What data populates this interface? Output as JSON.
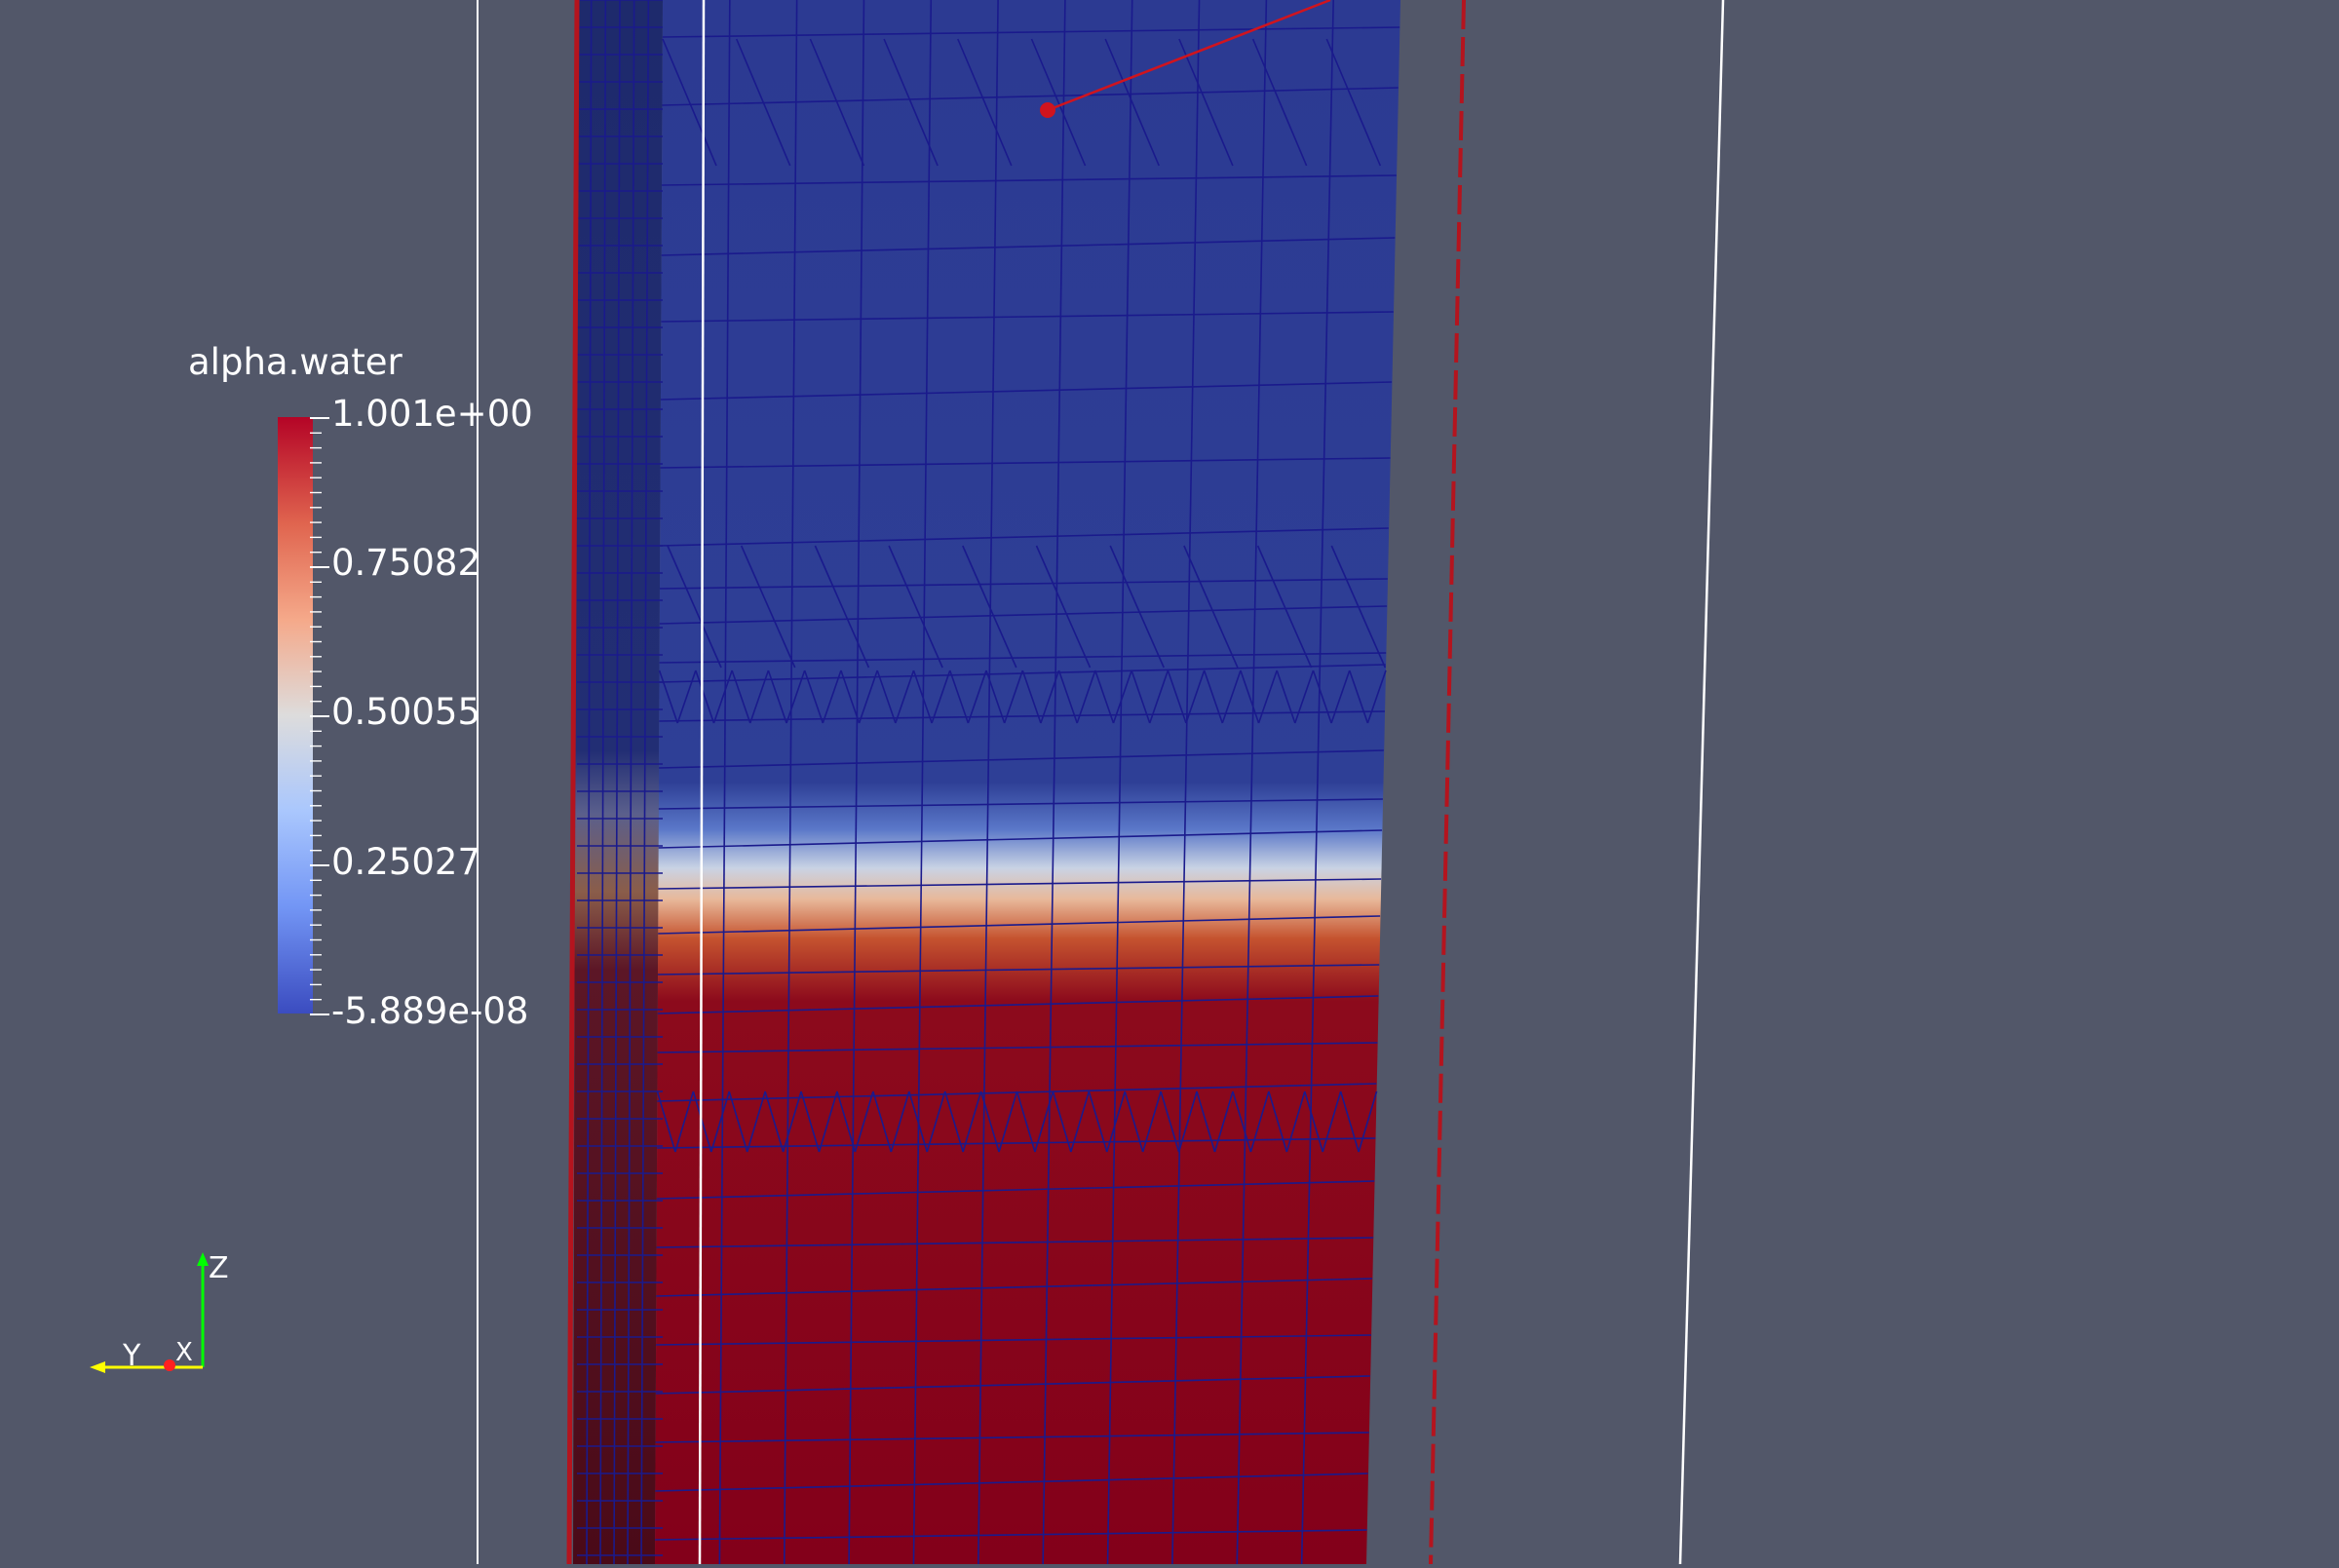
{
  "scalar_bar": {
    "title": "alpha.water",
    "labels": [
      "1.001e+00",
      "0.75082",
      "0.50055",
      "0.25027",
      "-5.889e-08"
    ],
    "range": [
      -5.889e-08,
      1.001
    ],
    "colormap": [
      "#3b4cc0",
      "#dddcdc",
      "#b40426"
    ]
  },
  "orientation_axes": {
    "z_label": "Z",
    "y_label": "Y",
    "x_label": "X",
    "colors": {
      "z": "#00ff00",
      "y": "#ffff00",
      "x": "#ff0000"
    }
  },
  "colors": {
    "background": "#525769",
    "mesh_edges": "#1a1a8c",
    "water": "#87001a",
    "air": "#2e3f96",
    "outline_red": "#b4141e",
    "outline_white": "#ffffff"
  }
}
